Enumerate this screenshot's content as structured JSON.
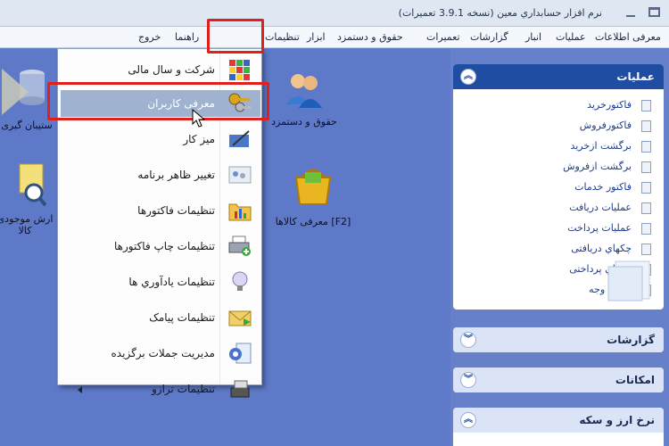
{
  "window": {
    "title": "نرم افزار حسابداري معین (نسخه 3.9.1 تعمیرات)"
  },
  "menubar": {
    "items": [
      "معرفی اطلاعات",
      "عملیات",
      "انبار",
      "گزارشات",
      "تعمیرات",
      "حقوق و دستمزد",
      "ابزار",
      "تنظیمات",
      "راهنما",
      "خروج"
    ]
  },
  "dropdown": {
    "items": [
      {
        "label": "شرکت و سال مالی",
        "icon": "rubik-cube-icon"
      },
      {
        "label": "معرفی کاربران",
        "icon": "keys-icon"
      },
      {
        "label": "میز کار",
        "icon": "desk-pen-icon"
      },
      {
        "label": "تغییر ظاهر برنامه",
        "icon": "paint-icon"
      },
      {
        "label": "تنظیمات فاکتورها",
        "icon": "folder-chart-icon"
      },
      {
        "label": "تنظیمات چاپ فاکتورها",
        "icon": "printer-icon"
      },
      {
        "label": "تنظیمات يادآوري ها",
        "icon": "bulb-icon"
      },
      {
        "label": "تنظیمات پیامک",
        "icon": "envelope-icon"
      },
      {
        "label": "مديريت جملات برگزيده",
        "icon": "gear-document-icon"
      },
      {
        "label": "تنظیمات ترازو",
        "icon": "scale-icon"
      }
    ]
  },
  "desktop": {
    "icons": [
      {
        "label": "حقوق و دستمزد",
        "icon": "people-icon"
      },
      {
        "label": "معرفی کالاها [F2]",
        "icon": "shopping-basket-icon"
      },
      {
        "label": "ستیبان گیری",
        "icon": "database-icon"
      },
      {
        "label": "ارش موجودی کالا",
        "icon": "report-magnifier-icon"
      }
    ]
  },
  "panels": {
    "operations": {
      "title": "عملیات",
      "links": [
        "فاکتورخرید",
        "فاکتورفروش",
        "برگشت ازخريد",
        "برگشت ازفروش",
        "فاکتور خدمات",
        "عملیات دريافت",
        "عملیات پرداخت",
        "چکهاي دريافتی",
        "چکهاي پرداختی",
        "انتقال وجه"
      ]
    },
    "reports": {
      "title": "گزارشات"
    },
    "features": {
      "title": "امکانات"
    },
    "rates": {
      "title": "نرخ ارز و سکه"
    }
  },
  "colors": {
    "accent": "#1f4da2",
    "highlight": "#e0211b",
    "desktop": "#5d79c7"
  }
}
